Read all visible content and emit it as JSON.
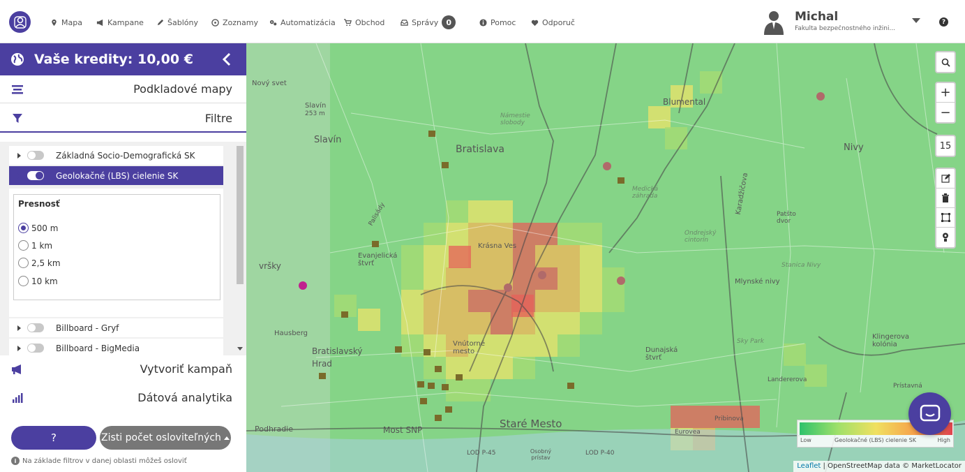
{
  "nav": {
    "items": [
      {
        "label": "Mapa",
        "icon": "map-pin-icon"
      },
      {
        "label": "Kampane",
        "icon": "megaphone-icon"
      },
      {
        "label": "Šablóny",
        "icon": "pencil-icon"
      },
      {
        "label": "Zoznamy",
        "icon": "list-icon"
      },
      {
        "label": "Automatizácia",
        "icon": "gears-icon"
      },
      {
        "label": "Obchod",
        "icon": "cart-icon"
      },
      {
        "label": "Správy",
        "icon": "inbox-icon",
        "badge": "0"
      },
      {
        "label": "Pomoc",
        "icon": "info-icon"
      },
      {
        "label": "Odporuč",
        "icon": "heart-icon"
      }
    ]
  },
  "user": {
    "name": "Michal",
    "subtitle": "Fakulta bezpečnostného inžini...",
    "help_icon": "?"
  },
  "sidebar": {
    "credits": "Vaše kredity: 10,00 €",
    "basemaps": "Podkladové mapy",
    "filters": "Filtre",
    "filter_rows": [
      {
        "label": "Základná Socio-Demografická SK",
        "enabled": false
      },
      {
        "label": "Geolokačné (LBS) cielenie SK",
        "enabled": true
      },
      {
        "label": "Billboard - Gryf",
        "enabled": false
      },
      {
        "label": "Billboard - BigMedia",
        "enabled": false
      }
    ],
    "precision": {
      "title": "Presnosť",
      "options": [
        "500 m",
        "1 km",
        "2,5 km",
        "10 km"
      ],
      "selected": "500 m"
    },
    "create_campaign": "Vytvoriť kampaň",
    "data_analytics": "Dátová analytika",
    "help_button": "?",
    "count_button": "Zisti počet osloviteľných",
    "note": "Na základe filtrov v danej oblasti môžeš osloviť"
  },
  "map": {
    "zoom": "15",
    "legend": {
      "low": "Low",
      "name": "Geolokačné (LBS) cielenie SK",
      "high": "High"
    },
    "attribution": {
      "leaflet": "Leaflet",
      "rest": " | OpenStreetMap data © MarketLocator"
    },
    "labels": {
      "bratislava": "Bratislava",
      "stare_mesto": "Staré Mesto",
      "bratislavsky_hrad": "Bratislavský Hrad",
      "vnutorne_mesto": "Vnútorné mesto",
      "krasna_ves": "Krásna Ves",
      "blumental": "Blumental",
      "nivy": "Nivy",
      "slavin": "Slavín",
      "slavin_peak": "Slavín",
      "slavin_elev": "253 m",
      "novy_svet": "Nový svet",
      "evanjelicka": "Evanjelická štvrť",
      "dunajska": "Dunajská štvrť",
      "most_snp": "Most SNP",
      "podhradie": "Podhradie",
      "medicka": "Medická záhrada",
      "stanica": "Stanica Nivy",
      "klingerova": "Klingerova kolónia",
      "mlynske_nivy": "Mlynské nivy",
      "landererova": "Landererova",
      "pristavna": "Prístavná",
      "eurovea": "Eurovea",
      "pribinova": "Pribinova",
      "hausberg": "Hausberg",
      "karadzicova": "Karadžičova",
      "stare_mesto_slobody": "Námestie slobody",
      "lod_p45": "LOD P-45",
      "lod_p40": "LOD P-40",
      "osobny_pristav": "Osobný prístav",
      "palisady": "Palisády",
      "sky_park": "Sky Park",
      "ondrejsky": "Ondrejský cintorín",
      "patsto": "Patšto dvor",
      "vrsky": "vršky"
    }
  },
  "colors": {
    "brand": "#4b3fa0",
    "map_base": "#8fd48a",
    "hot": "#e0434f",
    "warm": "#f0e060"
  }
}
